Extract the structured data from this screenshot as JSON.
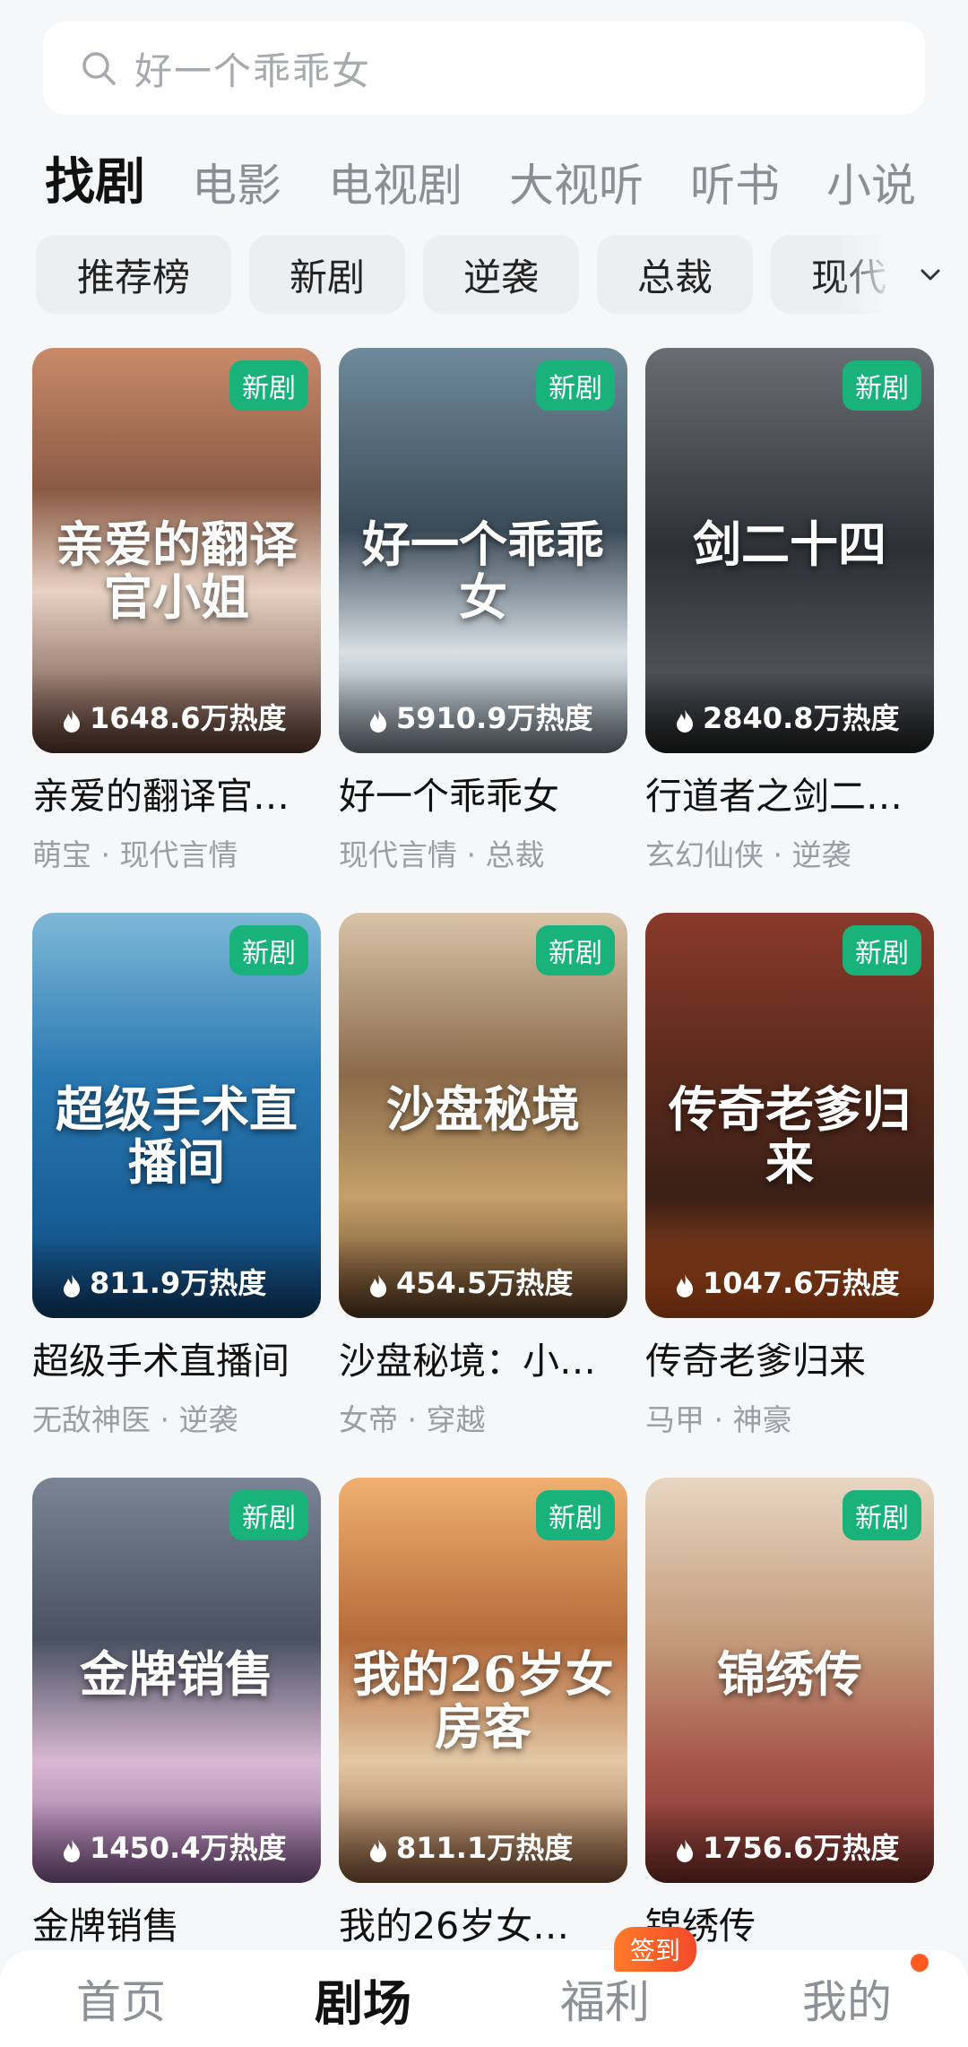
{
  "search": {
    "placeholder": "好一个乖乖女"
  },
  "tabs": [
    {
      "label": "找剧",
      "active": true
    },
    {
      "label": "电影"
    },
    {
      "label": "电视剧"
    },
    {
      "label": "大视听"
    },
    {
      "label": "听书"
    },
    {
      "label": "小说"
    }
  ],
  "chips": [
    "推荐榜",
    "新剧",
    "逆袭",
    "总裁",
    "现代"
  ],
  "cards": [
    {
      "title": "亲爱的翻译官…",
      "poster_text": "亲爱的翻译官小姐",
      "tags": "萌宝 · 现代言情",
      "heat": "1648.6万热度",
      "badge": "新剧"
    },
    {
      "title": "好一个乖乖女",
      "poster_text": "好一个乖乖女",
      "tags": "现代言情 · 总裁",
      "heat": "5910.9万热度",
      "badge": "新剧"
    },
    {
      "title": "行道者之剑二…",
      "poster_text": "剑二十四",
      "tags": "玄幻仙侠 · 逆袭",
      "heat": "2840.8万热度",
      "badge": "新剧"
    },
    {
      "title": "超级手术直播间",
      "poster_text": "超级手术直播间",
      "tags": "无敌神医 · 逆袭",
      "heat": "811.9万热度",
      "badge": "新剧"
    },
    {
      "title": "沙盘秘境：小…",
      "poster_text": "沙盘秘境",
      "tags": "女帝 · 穿越",
      "heat": "454.5万热度",
      "badge": "新剧"
    },
    {
      "title": "传奇老爹归来",
      "poster_text": "传奇老爹归来",
      "tags": "马甲 · 神豪",
      "heat": "1047.6万热度",
      "badge": "新剧"
    },
    {
      "title": "金牌销售",
      "poster_text": "金牌销售",
      "tags": "",
      "heat": "1450.4万热度",
      "badge": "新剧"
    },
    {
      "title": "我的26岁女…",
      "poster_text": "我的26岁女房客",
      "tags": "",
      "heat": "811.1万热度",
      "badge": "新剧"
    },
    {
      "title": "锦绣传",
      "poster_text": "锦绣传",
      "tags": "",
      "heat": "1756.6万热度",
      "badge": "新剧"
    }
  ],
  "bottom_nav": {
    "items": [
      "首页",
      "剧场",
      "福利",
      "我的"
    ],
    "active": "剧场",
    "welfare_badge": "签到"
  },
  "colors": {
    "badge_green": "#19b27a",
    "accent_orange": "#ff5a1f"
  }
}
